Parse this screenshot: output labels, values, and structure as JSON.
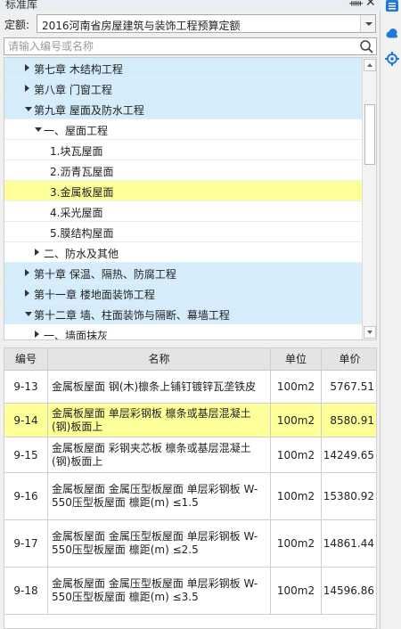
{
  "window": {
    "title": "标准库",
    "pin_glyph": "ᚔ",
    "close_glyph": "✕"
  },
  "quota": {
    "label": "定额:",
    "selected": "2016河南省房屋建筑与装饰工程预算定额"
  },
  "search": {
    "placeholder": "请输入编号或名称",
    "value": ""
  },
  "tree": {
    "items": [
      {
        "label": "第七章 木结构工程",
        "level": 1,
        "expanded": false,
        "kind": "chapter"
      },
      {
        "label": "第八章 门窗工程",
        "level": 1,
        "expanded": false,
        "kind": "chapter"
      },
      {
        "label": "第九章 屋面及防水工程",
        "level": 1,
        "expanded": true,
        "kind": "chapter"
      },
      {
        "label": "一、屋面工程",
        "level": 2,
        "expanded": true,
        "kind": "section"
      },
      {
        "label": "1.块瓦屋面",
        "level": 3,
        "kind": "leaf"
      },
      {
        "label": "2.沥青瓦屋面",
        "level": 3,
        "kind": "leaf"
      },
      {
        "label": "3.金属板屋面",
        "level": 3,
        "kind": "leaf",
        "selected": true
      },
      {
        "label": "4.采光屋面",
        "level": 3,
        "kind": "leaf"
      },
      {
        "label": "5.膜结构屋面",
        "level": 3,
        "kind": "leaf"
      },
      {
        "label": "二、防水及其他",
        "level": 2,
        "expanded": false,
        "kind": "section"
      },
      {
        "label": "第十章 保温、隔热、防腐工程",
        "level": 1,
        "expanded": false,
        "kind": "chapter"
      },
      {
        "label": "第十一章 楼地面装饰工程",
        "level": 1,
        "expanded": false,
        "kind": "chapter"
      },
      {
        "label": "第十二章 墙、柱面装饰与隔断、幕墙工程",
        "level": 1,
        "expanded": true,
        "kind": "chapter"
      },
      {
        "label": "一、墙面抹灰",
        "level": 2,
        "expanded": false,
        "kind": "section"
      }
    ]
  },
  "table": {
    "headers": {
      "code": "编号",
      "name": "名称",
      "unit": "单位",
      "price": "单价"
    },
    "rows": [
      {
        "code": "9-13",
        "name": "金属板屋面 钢(木)檩条上铺钉镀锌瓦垄铁皮",
        "unit": "100m2",
        "price": "5767.51",
        "selected": false
      },
      {
        "code": "9-14",
        "name": "金属板屋面 单层彩钢板 檩条或基层混凝土(钢)板面上",
        "unit": "100m2",
        "price": "8580.91",
        "selected": true
      },
      {
        "code": "9-15",
        "name": "金属板屋面 彩钢夹芯板 檩条或基层混凝土(钢)板面上",
        "unit": "100m2",
        "price": "14249.65",
        "selected": false
      },
      {
        "code": "9-16",
        "name": "金属板屋面 金属压型板屋面 单层彩钢板 W-550压型板屋面 檩距(m) ≤1.5",
        "unit": "100m2",
        "price": "15380.92",
        "selected": false
      },
      {
        "code": "9-17",
        "name": "金属板屋面 金属压型板屋面 单层彩钢板 W-550压型板屋面 檩距(m) ≤2.5",
        "unit": "100m2",
        "price": "14861.44",
        "selected": false
      },
      {
        "code": "9-18",
        "name": "金属板屋面 金属压型板屋面 单层彩钢板 W-550压型板屋面 檩距(m) ≤3.5",
        "unit": "100m2",
        "price": "14596.86",
        "selected": false
      }
    ]
  },
  "sidebar_icons": [
    "list-icon",
    "cloud-icon",
    "locate-icon"
  ],
  "colors": {
    "chapter_bg": "#d5ecfb",
    "selected_bg": "#ffff99",
    "accent": "#1e7ad6"
  }
}
